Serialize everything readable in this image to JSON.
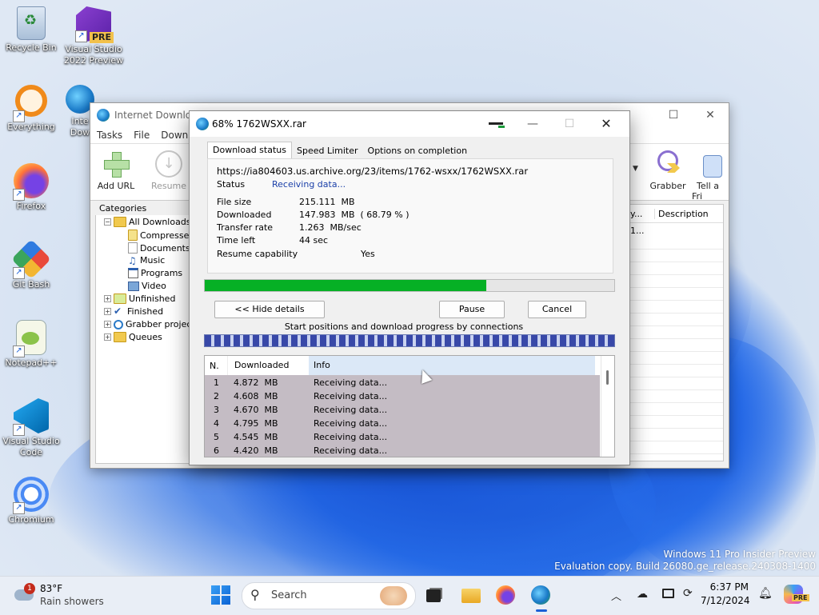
{
  "desktop": {
    "icons": [
      {
        "label": "Recycle Bin",
        "icon": "recycle-bin-icon"
      },
      {
        "label": "Visual Studio 2022 Preview",
        "icon": "visual-studio-preview-icon",
        "badge": "PRE"
      },
      {
        "label": "Everything",
        "icon": "everything-search-icon"
      },
      {
        "label": "Firefox",
        "icon": "firefox-icon"
      },
      {
        "label": "Git Bash",
        "icon": "git-bash-icon"
      },
      {
        "label": "Notepad++",
        "icon": "notepad-plus-plus-icon"
      },
      {
        "label": "Visual Studio Code",
        "icon": "vscode-icon"
      },
      {
        "label": "Chromium",
        "icon": "chromium-icon"
      },
      {
        "label": "Inte Dow",
        "icon": "idm-icon"
      }
    ],
    "watermark_line1": "Windows 11 Pro Insider Preview",
    "watermark_line2": "Evaluation copy. Build 26080.ge_release.240308-1400"
  },
  "idm_main": {
    "title": "Internet Downloa",
    "menu": [
      "Tasks",
      "File",
      "Downlo"
    ],
    "toolbar": {
      "add_url": "Add URL",
      "resume": "Resume",
      "grabber": "Grabber",
      "tell_friend": "Tell a Fri"
    },
    "categories_label": "Categories",
    "tree": [
      {
        "label": "All Downloads"
      },
      {
        "label": "Compresse"
      },
      {
        "label": "Documents"
      },
      {
        "label": "Music"
      },
      {
        "label": "Programs"
      },
      {
        "label": "Video"
      },
      {
        "label": "Unfinished"
      },
      {
        "label": "Finished"
      },
      {
        "label": "Grabber projec"
      },
      {
        "label": "Queues"
      }
    ],
    "list_columns": {
      "col1": "y...",
      "col2": "Description"
    },
    "list_row1": "1..."
  },
  "dialog": {
    "title": "68% 1762WSXX.rar",
    "tabs": [
      "Download status",
      "Speed Limiter",
      "Options on completion"
    ],
    "url": "https://ia804603.us.archive.org/23/items/1762-wsxx/1762WSXX.rar",
    "status_label": "Status",
    "status_value": "Receiving data...",
    "file_size_label": "File size",
    "file_size_value": "215.111  MB",
    "downloaded_label": "Downloaded",
    "downloaded_value": "147.983  MB  ( 68.79 % )",
    "transfer_rate_label": "Transfer rate",
    "transfer_rate_value": "1.263  MB/sec",
    "time_left_label": "Time left",
    "time_left_value": "44 sec",
    "resume_label": "Resume capability",
    "resume_value": "Yes",
    "progress_percent": 68.79,
    "hide_details": "<< Hide details",
    "pause": "Pause",
    "cancel": "Cancel",
    "connections_label": "Start positions and download progress by connections",
    "table_headers": {
      "n": "N.",
      "downloaded": "Downloaded",
      "info": "Info"
    },
    "connections": [
      {
        "n": "1",
        "downloaded": "4.872  MB",
        "info": "Receiving data..."
      },
      {
        "n": "2",
        "downloaded": "4.608  MB",
        "info": "Receiving data..."
      },
      {
        "n": "3",
        "downloaded": "4.670  MB",
        "info": "Receiving data..."
      },
      {
        "n": "4",
        "downloaded": "4.795  MB",
        "info": "Receiving data..."
      },
      {
        "n": "5",
        "downloaded": "4.545  MB",
        "info": "Receiving data..."
      },
      {
        "n": "6",
        "downloaded": "4.420  MB",
        "info": "Receiving data..."
      }
    ]
  },
  "taskbar": {
    "weather_temp": "83°F",
    "weather_desc": "Rain showers",
    "weather_badge": "1",
    "search_placeholder": "Search",
    "time": "6:37 PM",
    "date": "7/12/2024",
    "copilot_badge": "PRE"
  },
  "colors": {
    "progress": "#06b025",
    "accent": "#1a5fd6",
    "conn_bar": "#3848a8"
  }
}
